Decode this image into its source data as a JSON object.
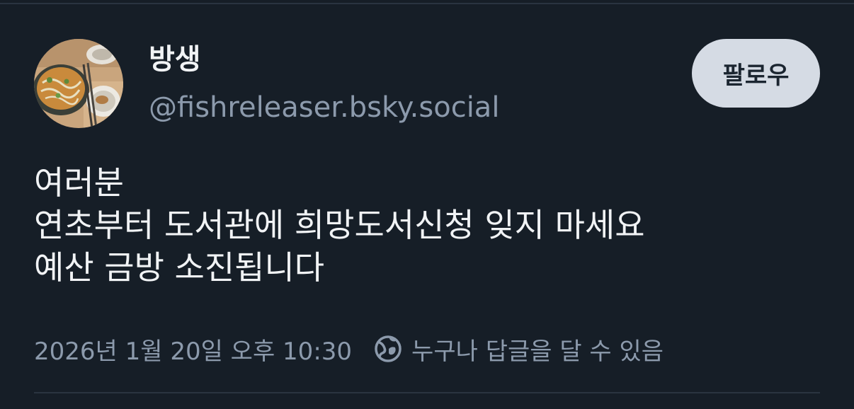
{
  "author": {
    "display_name": "방생",
    "handle": "@fishreleaser.bsky.social",
    "avatar_icon": "food-photo-avatar"
  },
  "follow_button": {
    "label": "팔로우"
  },
  "post": {
    "lines": [
      "여러분",
      "연초부터 도서관에 희망도서신청 잊지 마세요",
      "예산 금방 소진됩니다"
    ]
  },
  "meta": {
    "timestamp": "2026년 1월 20일 오후 10:30",
    "reply_setting_icon": "globe-icon",
    "reply_setting": "누구나 답글을 달 수 있음"
  },
  "colors": {
    "background": "#161e27",
    "primary_text": "#f1f3f5",
    "secondary_text": "#8c9aac",
    "button_bg": "#d5dbe4",
    "divider": "#2a3440"
  }
}
